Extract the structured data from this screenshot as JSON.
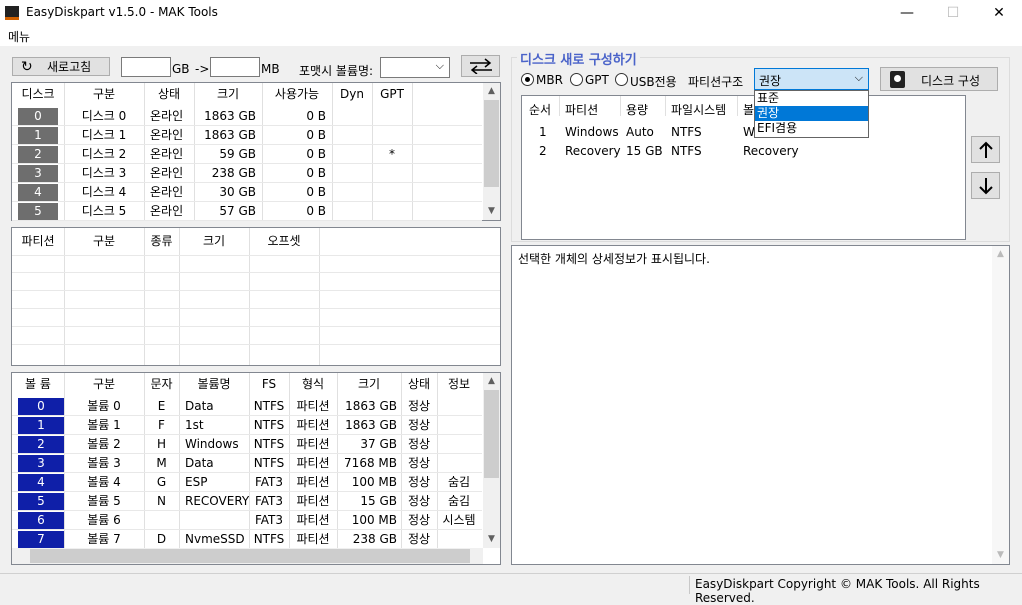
{
  "window": {
    "title": "EasyDiskpart v1.5.0 - MAK Tools",
    "minimize": "—",
    "maximize": "☐",
    "close": "✕"
  },
  "menu": {
    "label": "메뉴"
  },
  "toolbar": {
    "refresh_label": "새로고침",
    "gb_value": "",
    "gb_unit": "GB",
    "arrow": "->",
    "mb_value": "",
    "mb_unit": "MB",
    "volume_name_label": "포맷시 볼륨명:",
    "volume_name_value": "",
    "swap_icon": "swap-arrows"
  },
  "disk_table": {
    "headers": [
      "디스크",
      "구분",
      "상태",
      "크기",
      "사용가능",
      "Dyn",
      "GPT"
    ],
    "rows": [
      [
        "0",
        "디스크 0",
        "온라인",
        "1863 GB",
        "0 B",
        "",
        ""
      ],
      [
        "1",
        "디스크 1",
        "온라인",
        "1863 GB",
        "0 B",
        "",
        ""
      ],
      [
        "2",
        "디스크 2",
        "온라인",
        "59 GB",
        "0 B",
        "",
        "*"
      ],
      [
        "3",
        "디스크 3",
        "온라인",
        "238 GB",
        "0 B",
        "",
        ""
      ],
      [
        "4",
        "디스크 4",
        "온라인",
        "30 GB",
        "0 B",
        "",
        ""
      ],
      [
        "5",
        "디스크 5",
        "온라인",
        "57 GB",
        "0 B",
        "",
        ""
      ]
    ]
  },
  "partition_table": {
    "headers": [
      "파티션",
      "구분",
      "종류",
      "크기",
      "오프셋"
    ]
  },
  "volume_table": {
    "headers": [
      "볼 륨",
      "구분",
      "문자",
      "볼륨명",
      "FS",
      "형식",
      "크기",
      "상태",
      "정보"
    ],
    "rows": [
      [
        "0",
        "볼륨 0",
        "E",
        "Data",
        "NTFS",
        "파티션",
        "1863 GB",
        "정상",
        ""
      ],
      [
        "1",
        "볼륨 1",
        "F",
        "1st",
        "NTFS",
        "파티션",
        "1863 GB",
        "정상",
        ""
      ],
      [
        "2",
        "볼륨 2",
        "H",
        "Windows",
        "NTFS",
        "파티션",
        "37 GB",
        "정상",
        ""
      ],
      [
        "3",
        "볼륨 3",
        "M",
        "Data",
        "NTFS",
        "파티션",
        "7168 MB",
        "정상",
        ""
      ],
      [
        "4",
        "볼륨 4",
        "G",
        "ESP",
        "FAT3",
        "파티션",
        "100 MB",
        "정상",
        "숨김"
      ],
      [
        "5",
        "볼륨 5",
        "N",
        "RECOVERY",
        "FAT3",
        "파티션",
        "15 GB",
        "정상",
        "숨김"
      ],
      [
        "6",
        "볼륨 6",
        "",
        "",
        "FAT3",
        "파티션",
        "100 MB",
        "정상",
        "시스템"
      ],
      [
        "7",
        "볼륨 7",
        "D",
        "NvmeSSD",
        "NTFS",
        "파티션",
        "238 GB",
        "정상",
        ""
      ]
    ]
  },
  "reconfig": {
    "group_title": "디스크 새로 구성하기",
    "mbr_label": "MBR",
    "gpt_label": "GPT",
    "usb_label": "USB전용",
    "partition_structure_label": "파티션구조",
    "partition_structure_value": "권장",
    "dropdown_options": [
      "표준",
      "권장",
      "EFI겸용"
    ],
    "dropdown_selected_index": 1,
    "compose_label": "디스크 구성",
    "layout_headers": [
      "순서",
      "파티션",
      "용량",
      "파일시스템",
      "볼"
    ],
    "layout_rows": [
      [
        "1",
        "Windows",
        "Auto",
        "NTFS",
        "W"
      ],
      [
        "2",
        "Recovery",
        "15 GB",
        "NTFS",
        "Recovery"
      ]
    ]
  },
  "details": {
    "text": "선택한 개체의 상세정보가 표시됩니다."
  },
  "status": {
    "copyright": "EasyDiskpart Copyright © MAK Tools. All Rights Reserved."
  },
  "colors": {
    "disk_index_bg": "#6e6e6e",
    "volume_index_bg": "#0f1fa8",
    "group_title": "#4a63c9",
    "selection": "#0078d7"
  }
}
